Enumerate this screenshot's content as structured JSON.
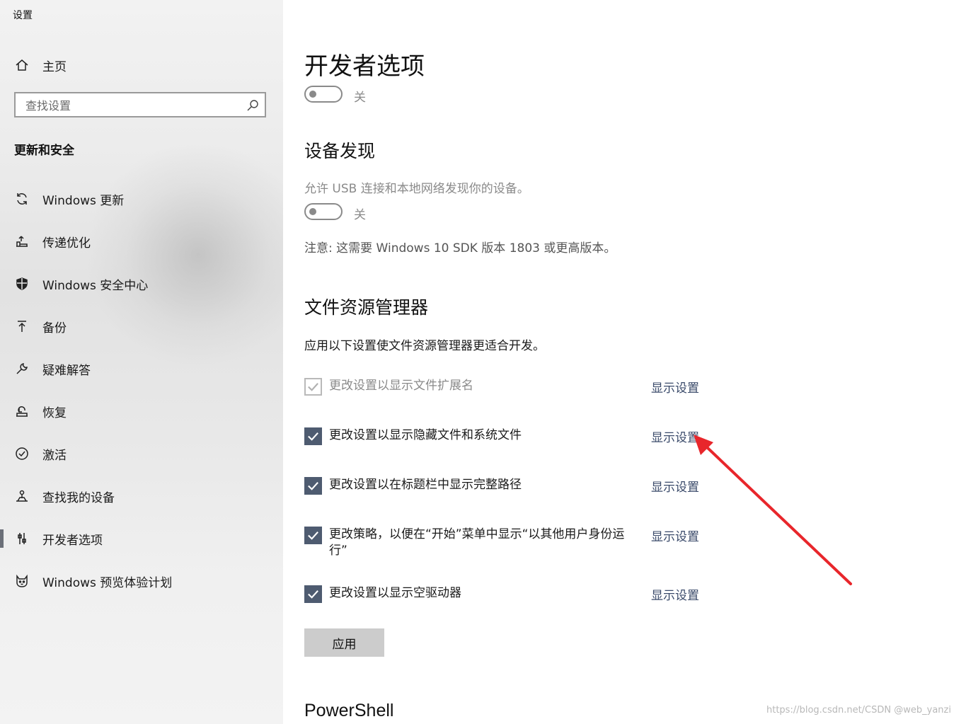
{
  "window": {
    "title": "设置"
  },
  "sidebar": {
    "home_label": "主页",
    "search_placeholder": "查找设置",
    "section_title": "更新和安全",
    "items": [
      {
        "label": "Windows 更新",
        "icon": "refresh-icon"
      },
      {
        "label": "传递优化",
        "icon": "delivery-icon"
      },
      {
        "label": "Windows 安全中心",
        "icon": "shield-icon"
      },
      {
        "label": "备份",
        "icon": "backup-arrow-icon"
      },
      {
        "label": "疑难解答",
        "icon": "wrench-icon"
      },
      {
        "label": "恢复",
        "icon": "recovery-icon"
      },
      {
        "label": "激活",
        "icon": "check-circle-icon"
      },
      {
        "label": "查找我的设备",
        "icon": "person-locate-icon"
      },
      {
        "label": "开发者选项",
        "icon": "sliders-icon",
        "active": true
      },
      {
        "label": "Windows 预览体验计划",
        "icon": "cat-icon"
      }
    ]
  },
  "main": {
    "developer_mode": {
      "title": "开发者选项",
      "toggle_state": "关"
    },
    "device_discovery": {
      "title": "设备发现",
      "description": "允许 USB 连接和本地网络发现你的设备。",
      "toggle_state": "关",
      "note": "注意: 这需要 Windows 10 SDK 版本 1803 或更高版本。"
    },
    "file_explorer": {
      "title": "文件资源管理器",
      "description": "应用以下设置使文件资源管理器更适合开发。",
      "options": [
        {
          "label": "更改设置以显示文件扩展名",
          "checked": true,
          "disabled": true,
          "link": "显示设置"
        },
        {
          "label": "更改设置以显示隐藏文件和系统文件",
          "checked": true,
          "disabled": false,
          "link": "显示设置"
        },
        {
          "label": "更改设置以在标题栏中显示完整路径",
          "checked": true,
          "disabled": false,
          "link": "显示设置"
        },
        {
          "label": "更改策略，以便在“开始”菜单中显示“以其他用户身份运行”",
          "checked": true,
          "disabled": false,
          "link": "显示设置"
        },
        {
          "label": "更改设置以显示空驱动器",
          "checked": true,
          "disabled": false,
          "link": "显示设置"
        }
      ],
      "apply_label": "应用"
    },
    "powershell": {
      "title": "PowerShell"
    }
  },
  "watermark": "https://blog.csdn.net/CSDN @web_yanzi",
  "colors": {
    "checkbox": "#4e5b70",
    "link": "#3a4a6a",
    "annotation_arrow": "#e8262b"
  }
}
